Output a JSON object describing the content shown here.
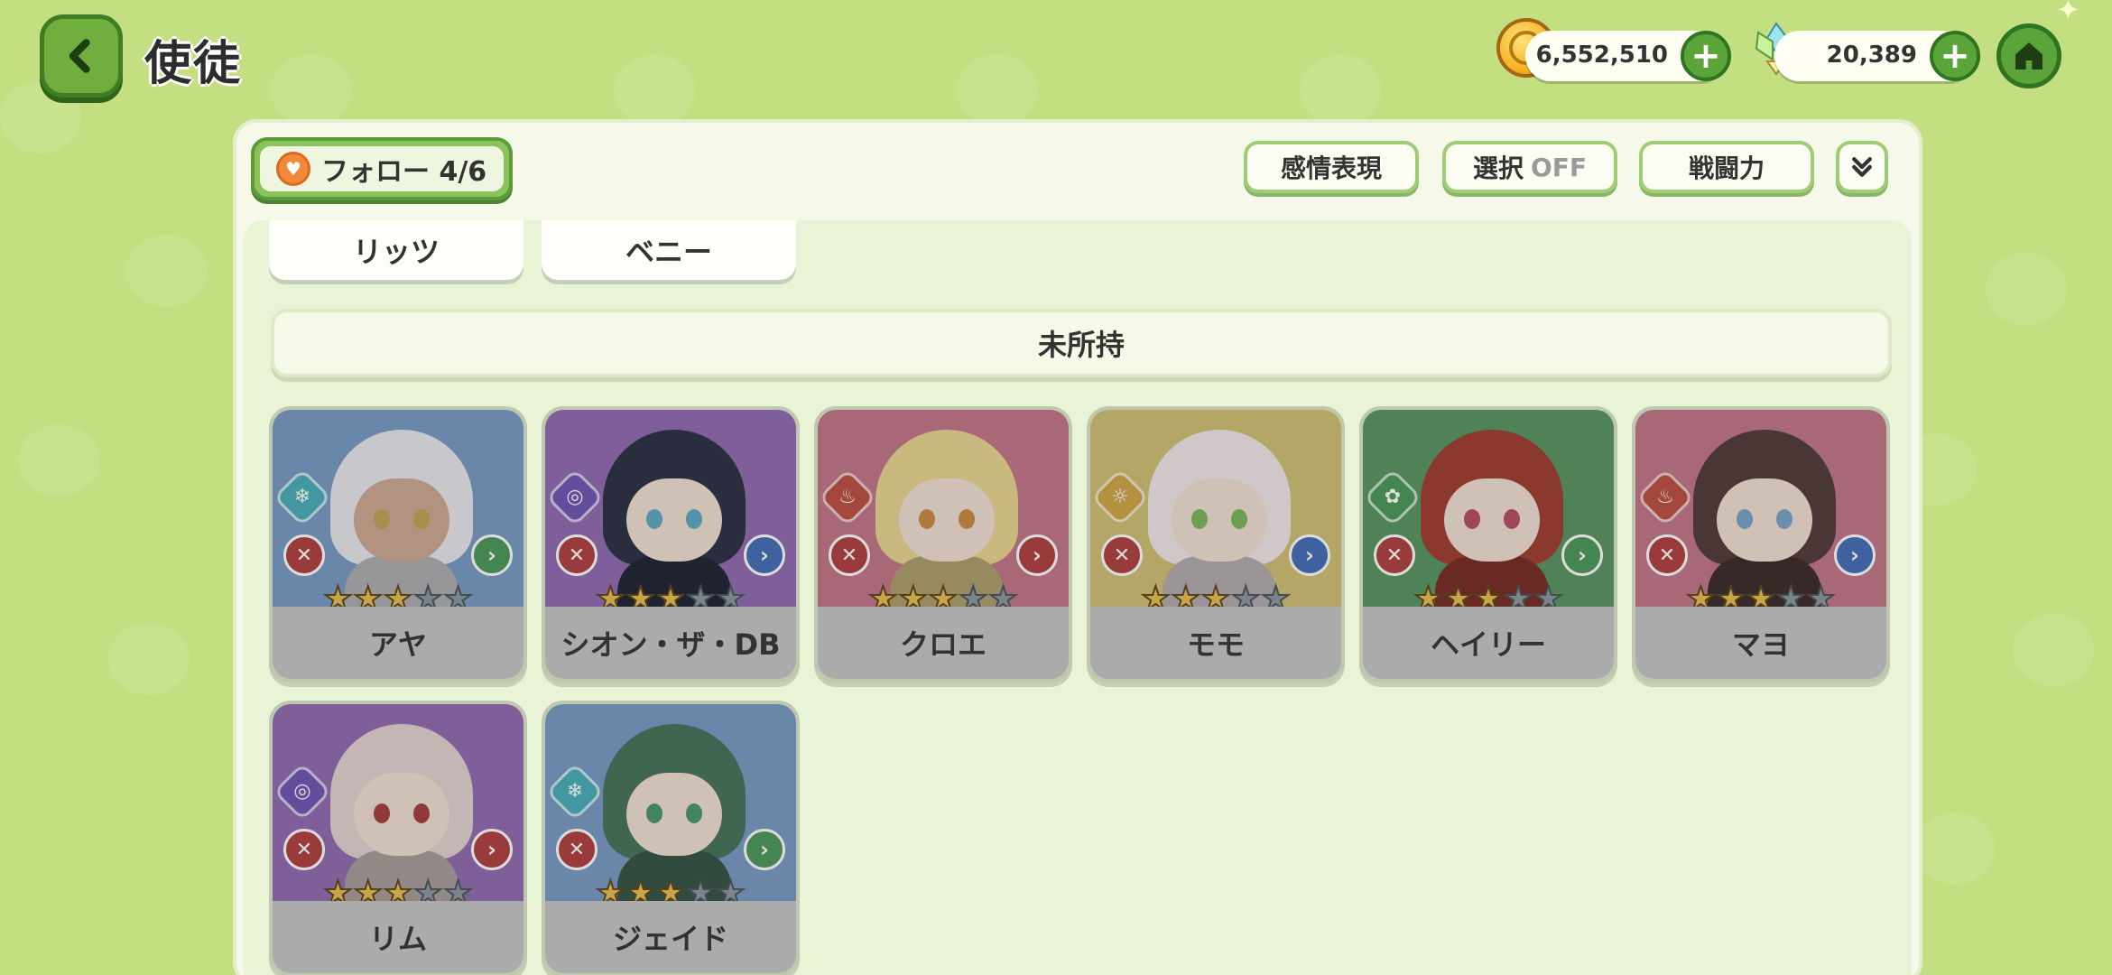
{
  "header": {
    "title": "使徒",
    "coins": "6,552,510",
    "crystals": "20,389"
  },
  "toolbar": {
    "follow_label": "フォロー 4/6",
    "emotion_label": "感情表現",
    "select_label": "選択",
    "select_state": "OFF",
    "power_label": "戦闘力"
  },
  "owned_tabs": [
    "リッツ",
    "ベニー"
  ],
  "section_title": "未所持",
  "colors": {
    "background": "#c3df82",
    "accent_green": "#5aa43a",
    "panel": "#f6f9ea",
    "name_plate": "#c7c7c7"
  },
  "characters": [
    {
      "name": "アヤ",
      "stars": 3,
      "max_stars": 5,
      "bg": "#6f9fd6",
      "element": "ice-icon",
      "element_color": "#2fb7c7",
      "type": "green",
      "hair": "#e9e9ef",
      "eyes": "#c9a63a",
      "skin": "#d9a98a"
    },
    {
      "name": "シオン・ザ・DB",
      "stars": 3,
      "max_stars": 5,
      "bg": "#9d6ac9",
      "element": "spiral-icon",
      "element_color": "#7a55d4",
      "type": "blue",
      "hair": "#2e3450",
      "eyes": "#4ab0d6",
      "skin": "#f7dfcf"
    },
    {
      "name": "クロエ",
      "stars": 3,
      "max_stars": 5,
      "bg": "#d9728a",
      "element": "flame-icon",
      "element_color": "#e04a3a",
      "type": "red",
      "hair": "#f2d77a",
      "eyes": "#e28a2a",
      "skin": "#f7dfcf"
    },
    {
      "name": "モモ",
      "stars": 3,
      "max_stars": 5,
      "bg": "#d9c25a",
      "element": "sun-icon",
      "element_color": "#e1a826",
      "type": "blue",
      "hair": "#f4e6e9",
      "eyes": "#6fbf45",
      "skin": "#f7dfcf"
    },
    {
      "name": "ヘイリー",
      "stars": 3,
      "max_stars": 5,
      "bg": "#4c9e58",
      "element": "leaf-icon",
      "element_color": "#3aa34f",
      "type": "green",
      "hair": "#c0392b",
      "eyes": "#d64a6a",
      "skin": "#f7dfcf"
    },
    {
      "name": "マヨ",
      "stars": 3,
      "max_stars": 5,
      "bg": "#d9728a",
      "element": "flame-icon",
      "element_color": "#e04a3a",
      "type": "blue",
      "hair": "#5a3f3a",
      "eyes": "#6fa8d8",
      "skin": "#f7dfcf"
    },
    {
      "name": "リム",
      "stars": 3,
      "max_stars": 5,
      "bg": "#9d6ac9",
      "element": "spiral-icon",
      "element_color": "#7a55d4",
      "type": "red",
      "hair": "#e7d3cf",
      "eyes": "#c73a3a",
      "skin": "#f7dfcf"
    },
    {
      "name": "ジェイド",
      "stars": 3,
      "max_stars": 5,
      "bg": "#6f9fd6",
      "element": "ice-icon",
      "element_color": "#2fb7c7",
      "type": "green",
      "hair": "#3e7a5a",
      "eyes": "#3aa06a",
      "skin": "#f7dfcf"
    }
  ]
}
